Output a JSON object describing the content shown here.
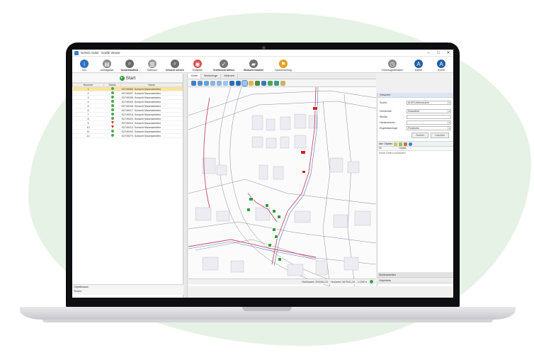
{
  "colors": {
    "accent": "#3a7bd5",
    "selected_row": "#ffe39a",
    "marker_green": "#2e9e3a",
    "marker_red": "#d42020",
    "background_blob": "#e7f2e6"
  },
  "window": {
    "title": "NANO mobil - Grafik Viewer",
    "minimize": "–",
    "maximize": "□",
    "close": "✕"
  },
  "toolbar": [
    {
      "label": "Info",
      "icon": "info-icon",
      "color": "#2f6fbf",
      "glyph": "i"
    },
    {
      "label": "Aufträgsliste",
      "icon": "clipboard-icon",
      "color": "#8a8a8a",
      "glyph": "▤"
    },
    {
      "label": "Schachtauffind",
      "icon": "search-icon",
      "color": "#6b6b6b",
      "glyph": "⌕",
      "bold": true
    },
    {
      "label": "Datenzon",
      "icon": "document-icon",
      "color": "#9a9a9a",
      "glyph": "▥"
    },
    {
      "label": "Schacht suchen",
      "icon": "magnifier-icon",
      "color": "#6b6b6b",
      "glyph": "⌕",
      "bold": true
    },
    {
      "label": "Einfärben",
      "icon": "color-wheel-icon",
      "color": "#d9534f",
      "glyph": "◉"
    },
    {
      "label": "Grafikmodi wählen",
      "icon": "checkmark-icon",
      "color": "#777777",
      "glyph": "✓",
      "bold": true
    },
    {
      "label": "Bildschirmabbild",
      "icon": "truck-icon",
      "color": "#707070",
      "glyph": "▰",
      "bold": true
    },
    {
      "label": "Sprintenauftrag",
      "icon": "flag-icon",
      "color": "#e0a020",
      "glyph": "⚑"
    },
    {
      "label": "Fahrzeugdateiname",
      "icon": "clock-icon",
      "color": "#8a8a8a",
      "glyph": "◷"
    },
    {
      "label": "Kleiner",
      "icon": "font-smaller-icon",
      "color": "#1f5fa8",
      "glyph": "A"
    },
    {
      "label": "Größer",
      "icon": "font-larger-icon",
      "color": "#1f5fa8",
      "glyph": "A"
    }
  ],
  "start": {
    "label": "Start"
  },
  "table": {
    "columns": [
      "Nummer",
      "Status",
      "Name"
    ],
    "rows": [
      {
        "nr": "1",
        "status": "ok",
        "name": "S2749080. Schacht Mauerarbeiten",
        "selected": true
      },
      {
        "nr": "2",
        "status": "ok",
        "name": "S2749207. Schacht Mauerarbeiten"
      },
      {
        "nr": "3",
        "status": "ok",
        "name": "S2749208. Schacht Mauerarbeiten"
      },
      {
        "nr": "4",
        "status": "ok",
        "name": "S2749209. Schacht Mauerarbeiten"
      },
      {
        "nr": "5",
        "status": "ok",
        "name": "S2749198. Schacht Mauerarbeiten"
      },
      {
        "nr": "6",
        "status": "ok",
        "name": "S2749217. Schacht Mauerarbeiten"
      },
      {
        "nr": "7",
        "status": "ok",
        "name": "S2749218. Schacht Mauerarbeiten"
      },
      {
        "nr": "8",
        "status": "ok",
        "name": "S2749220. Schacht Mauerarbeiten"
      },
      {
        "nr": "9",
        "status": "warn",
        "name": "S2749219. Schacht Mauerarbeiten"
      },
      {
        "nr": "10",
        "status": "warn",
        "name": "S2749212. Schacht Mauerarbeiten"
      },
      {
        "nr": "11",
        "status": "ok",
        "name": "S2749334. Schacht Mauerarbeiten"
      },
      {
        "nr": "12",
        "status": "ok",
        "name": "S2749270. Schacht Mauerarbeiten"
      }
    ]
  },
  "left_footer": {
    "line1": "Objektklasse:",
    "line2": "Termin:"
  },
  "map_tabs": [
    {
      "label": "Karte",
      "active": true
    },
    {
      "label": "Werkzeuge"
    },
    {
      "label": "Aktionen"
    }
  ],
  "map_status": {
    "rechtswert": "Rechtswert: 2934441,02",
    "hochwert": "Hochwert: 5679211,34",
    "scale": "1:2000 ▾"
  },
  "right_panel": {
    "header": "Ortsuche",
    "suche_label": "Suche:",
    "suche_value": "ALKIS Adresssuche",
    "gemeinde_label": "Gemeinde:",
    "gemeinde_value": "Düsseldorf",
    "strasse_label": "Straße:",
    "strasse_value": "",
    "hausnummer_label": "Hausnummer:",
    "hausnummer_value": "",
    "ergebnis_label": "Ergebnismenge:",
    "ergebnis_value": "Flurstücke",
    "btn_suchen": "Suchen",
    "btn_loeschen": "Löschen",
    "objects_header": "Alle Objekte",
    "col_nr": "Nr",
    "col_objekt": "Objekt",
    "empty_text": "Keine Daten vorhanden",
    "sicht_label": "Sichtbarkeiten",
    "objektinfo_label": "Objektinfo"
  }
}
